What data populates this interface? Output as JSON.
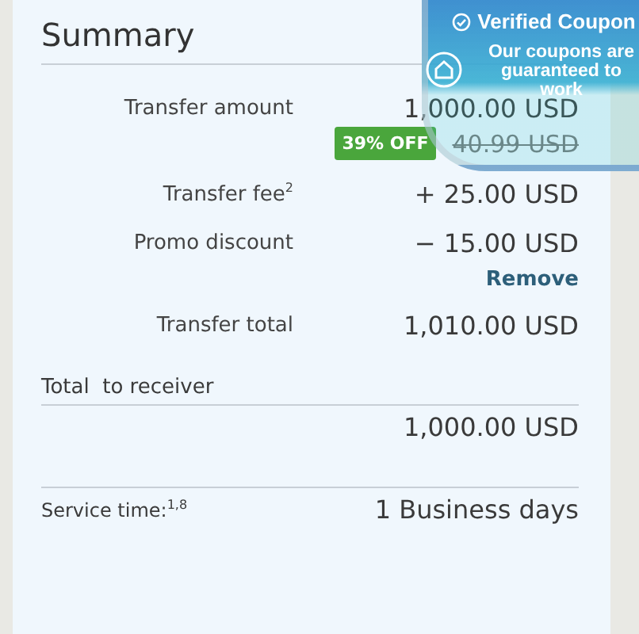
{
  "summary": {
    "title": "Summary",
    "rows": [
      {
        "kind": "amount",
        "label": "Transfer amount",
        "value": "1,000.00 USD"
      },
      {
        "kind": "discount",
        "badge": "39% OFF",
        "old_value": "40.99 USD"
      },
      {
        "kind": "amount",
        "label": "Transfer fee$^{2}$",
        "value": "+ 25.00 USD"
      },
      {
        "kind": "amount",
        "label": "Promo discount",
        "value": "− 15.00 USD"
      },
      {
        "kind": "link",
        "label": "Remove"
      },
      {
        "kind": "amount",
        "label": "Transfer total",
        "value": "1,010.00 USD"
      }
    ],
    "receiver": {
      "label": "Total  to receiver",
      "value": "1,000.00 USD"
    },
    "service": {
      "label": "Service time:$^{1,8}$",
      "value": "1 Business days"
    }
  },
  "coupon_popup": {
    "title": "Verified Coupon",
    "message": "Our coupons are guaranteed to work"
  }
}
